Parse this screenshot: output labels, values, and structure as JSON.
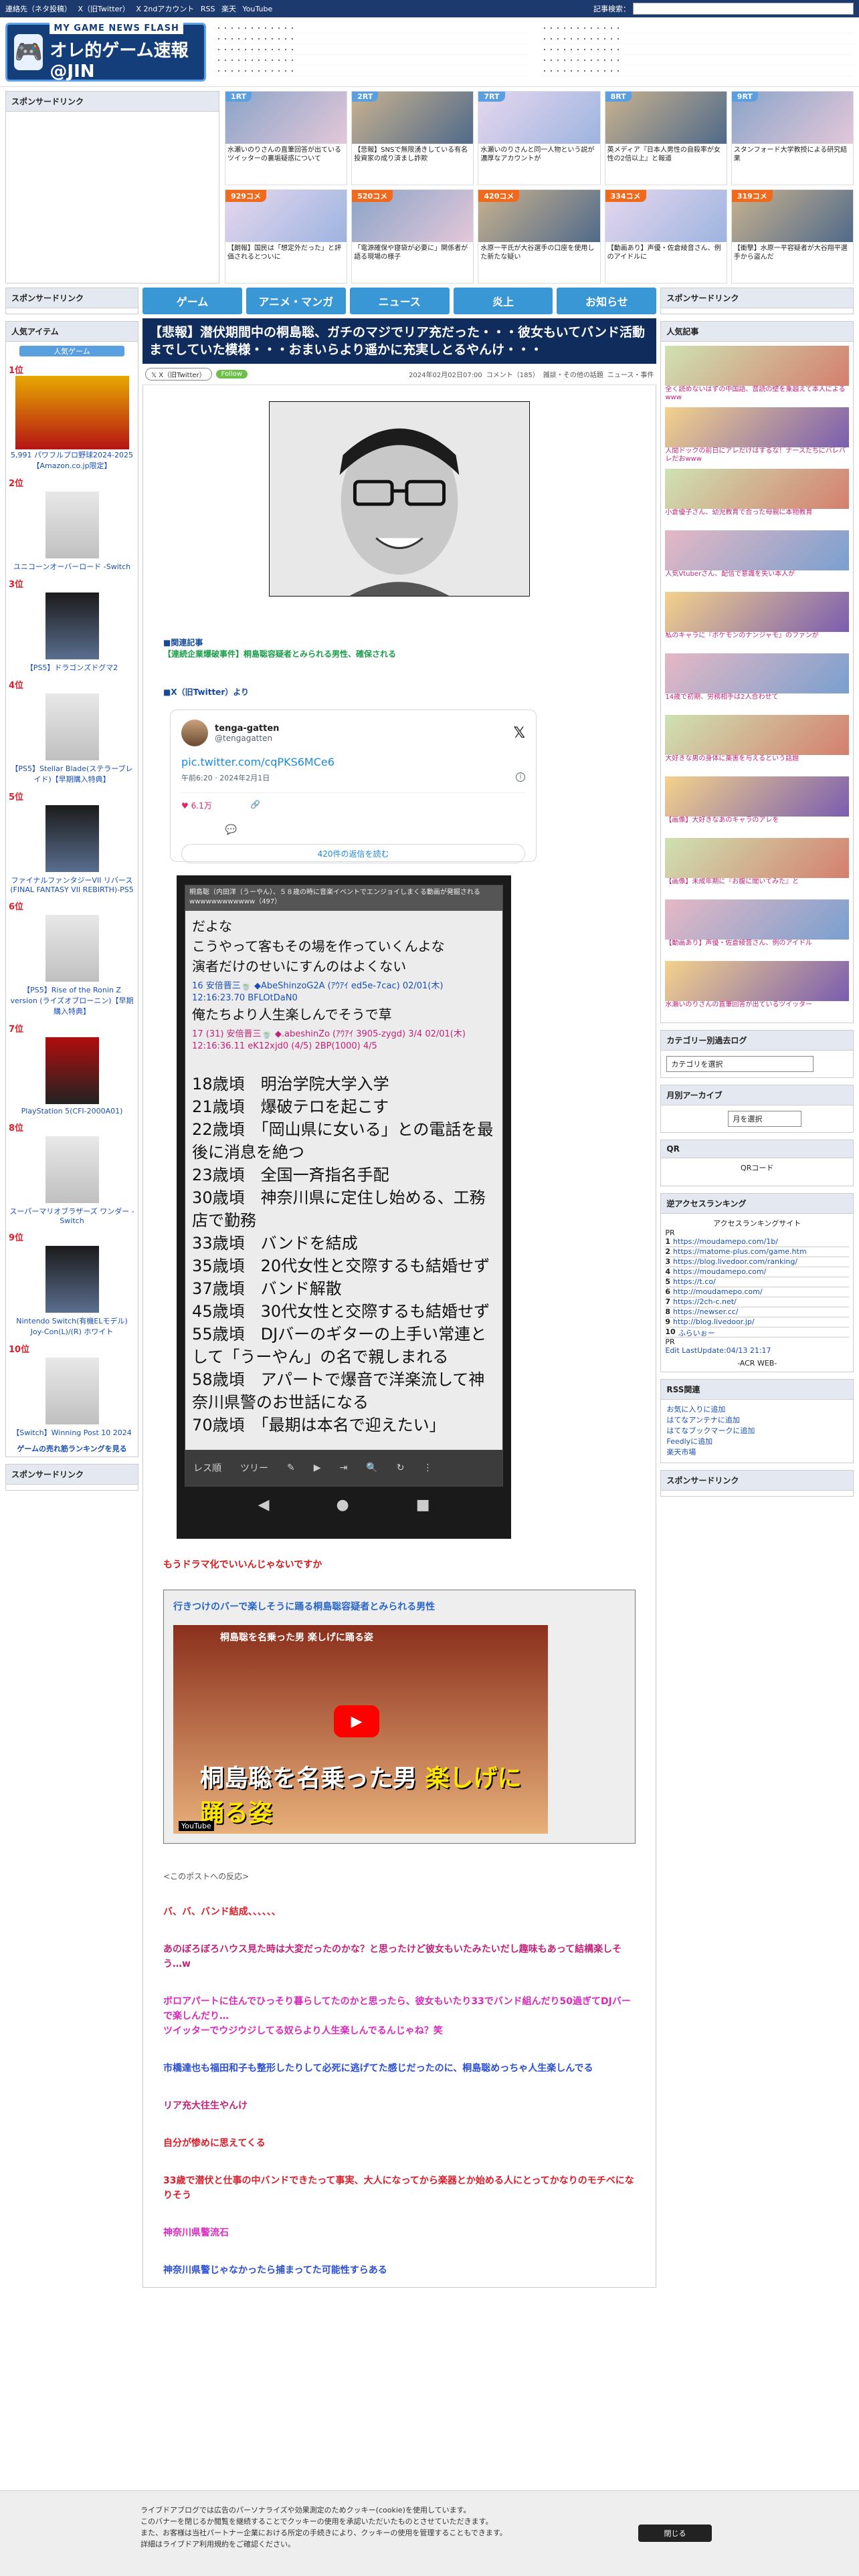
{
  "topbar": {
    "links": [
      "連絡先（ネタ投稿）",
      "X（旧Twitter）",
      "X 2ndアカウント",
      "RSS",
      "楽天",
      "YouTube"
    ],
    "search_label": "記事検索："
  },
  "site": {
    "tagline": "MY GAME NEWS FLASH",
    "name": "オレ的ゲーム速報@JIN"
  },
  "sponsor_label": "スポンサードリンク",
  "rank_cards": [
    {
      "badge": "1RT",
      "text": "水瀬いのりさんの直筆回答が出ているツイッターの裏垢疑惑について"
    },
    {
      "badge": "2RT",
      "text": "【悲報】SNSで無限湧きしている有名投資家の成り済まし詐欺"
    },
    {
      "badge": "7RT",
      "text": "水瀬いのりさんと同一人物という説が濃厚なアカウントが"
    },
    {
      "badge": "8RT",
      "text": "英メディア『日本人男性の自殺率が女性の2倍以上』と報道"
    },
    {
      "badge": "9RT",
      "text": "スタンフォード大学教授による研究結果"
    },
    {
      "badge": "929コメ",
      "text": "【朗報】国民は「想定外だった」と評価されるとついに"
    },
    {
      "badge": "520コメ",
      "text": "「電源確保や寝袋が必要に」関係者が語る現場の様子"
    },
    {
      "badge": "420コメ",
      "text": "水原一平氏が大谷選手の口座を使用した新たな疑い"
    },
    {
      "badge": "334コメ",
      "text": "【動画あり】声優・佐倉綾音さん、例のアイドルに"
    },
    {
      "badge": "319コメ",
      "text": "【衝撃】水原一平容疑者が大谷翔平選手から盗んだ"
    }
  ],
  "nav": [
    "ゲーム",
    "アニメ・マンガ",
    "ニュース",
    "炎上",
    "お知らせ"
  ],
  "article": {
    "title": "【悲報】潜伏期間中の桐島聡、ガチのマジでリア充だった・・・彼女もいてバンド活動までしていた模様・・・おまいらより遥かに充実しとるやんけ・・・",
    "follow": "Follow",
    "x": "X（旧Twitter）",
    "date": "2024年02月02日07:00",
    "comments": "コメント（185）",
    "category": "雑談・その他の話題",
    "tags": "ニュース・事件",
    "related_label": "■関連記事",
    "related_link": "【連続企業爆破事件】桐島聡容疑者とみられる男性、確保される",
    "x_section": "■X（旧Twitter）より",
    "tweet": {
      "name": "tenga-gatten",
      "handle": "@tengagatten",
      "body_link": "pic.twitter.com/cqPKS6MCe6",
      "date": "午前6:20 · 2024年2月1日",
      "likes": "6.1万",
      "reply_btn": "420件の返信を読む"
    },
    "phone": {
      "title": "桐島聡（内田洋（うーやん）、５８歳の時に音楽イベントでエンジョイしまくる動画が発掘されるwwwwwwwwwwww（497）",
      "lines1": [
        "だよな",
        "こうやって客もその場を作っていくんよな",
        "演者だけのせいにすんのはよくない"
      ],
      "r16": "16 安倍晋三🍵 ◆AbeShinzoG2A (ｱｳｱｲ ed5e-7cac) 02/01(木) 12:16:23.70 BFLOtDaN0",
      "l16": "俺たちより人生楽しんでそうで草",
      "r17": "17 (31) 安倍晋三🍵 ◆.abeshinZo (ｱｳｱｲ 3905-zygd) 3/4 02/01(木) 12:16:36.11 eK12xjd0 (4/5) 2BP(1000) 4/5",
      "life": [
        "18歳頃　明治学院大学入学",
        "21歳頃　爆破テロを起こす",
        "22歳頃　「岡山県に女いる」との電話を最後に消息を絶つ",
        "23歳頃　全国一斉指名手配",
        "30歳頃　神奈川県に定住し始める、工務店で勤務",
        "33歳頃　バンドを結成",
        "35歳頃　20代女性と交際するも結婚せず",
        "37歳頃　バンド解散",
        "45歳頃　30代女性と交際するも結婚せず",
        "55歳頃　DJバーのギターの上手い常連として「うーやん」の名で親しまれる",
        "58歳頃　アパートで爆音で洋楽流して神奈川県警のお世話になる",
        "70歳頃　「最期は本名で迎えたい」"
      ],
      "bar": [
        "レス順",
        "ツリー"
      ]
    },
    "caption": "もうドラマ化でいいんじゃないですか",
    "video_head": "行きつけのバーで楽しそうに踊る桐島聡容疑者とみられる男性",
    "video_title": "桐島聡を名乗った男 楽しげに踊る姿",
    "video_cap1": "桐島聡を名乗った男",
    "video_cap2": "楽しげに踊る姿",
    "youtube": "YouTube",
    "reactions_label": "<このポストへの反応>",
    "reactions": [
      {
        "t": "バ、バ、バンド結成、、、、、、",
        "c": "red"
      },
      {
        "t": "あのぼろぼろハウス見た時は大変だったのかな？と思ったけど彼女もいたみたいだし趣味もあって結構楽しそう…w",
        "c": "pink"
      },
      {
        "t": "ボロアパートに住んでひっそり暮らしてたのかと思ったら、彼女もいたり33でバンド組んだり50過ぎてDJバーで楽しんだり…\nツイッターでウジウジしてる奴らより人生楽しんでるんじゃね？笑",
        "c": "mag"
      },
      {
        "t": "市橋達也も福田和子も整形したりして必死に逃げてた感じだったのに、桐島聡めっちゃ人生楽しんでる",
        "c": "blue"
      },
      {
        "t": "リア充大往生やんけ",
        "c": "pink"
      },
      {
        "t": "自分が惨めに思えてくる",
        "c": "red"
      },
      {
        "t": "33歳で潜伏と仕事の中バンドできたって事実、大人になってから楽器とか始める人にとってかなりのモチベになりそう",
        "c": "red"
      },
      {
        "t": "神奈川県警流石",
        "c": "mag"
      },
      {
        "t": "神奈川県警じゃなかったら捕まってた可能性すらある",
        "c": "blue"
      }
    ]
  },
  "left": {
    "title": "人気アイテム",
    "tag": "人気ゲーム",
    "items": [
      {
        "no": "1位",
        "name": "5,991 パワフルプロ野球2024-2025 【Amazon.co.jp限定】"
      },
      {
        "no": "2位",
        "name": "ユニコーンオーバーロード -Switch"
      },
      {
        "no": "3位",
        "name": "【PS5】ドラゴンズドグマ2"
      },
      {
        "no": "4位",
        "name": "【PS5】Stellar Blade(ステラーブレイド)【早期購入特典】"
      },
      {
        "no": "5位",
        "name": "ファイナルファンタジーVII リバース(FINAL FANTASY VII REBIRTH)-PS5"
      },
      {
        "no": "6位",
        "name": "【PS5】Rise of the Ronin Z version (ライズオブローニン)【早期購入特典】"
      },
      {
        "no": "7位",
        "name": "PlayStation 5(CFI-2000A01)"
      },
      {
        "no": "8位",
        "name": "スーパーマリオブラザーズ ワンダー -Switch"
      },
      {
        "no": "9位",
        "name": "Nintendo Switch(有機ELモデル) Joy-Con(L)/(R) ホワイト"
      },
      {
        "no": "10位",
        "name": "【Switch】Winning Post 10 2024"
      }
    ],
    "more": "ゲームの売れ筋ランキングを見る",
    "sponsor2": "スポンサードリンク"
  },
  "right": {
    "sponsor": "スポンサードリンク",
    "popular": "人気記事",
    "pop_items": [
      "全く読めないはずの中国語、音読の壁を乗越えて本人によるwww",
      "人間ドックの前日にアレだけはするな！ナースたちにバレバレだおwww",
      "小倉優子さん、幼児教育で合った母親に本物教育",
      "人気Vtuberさん、配信で意識を失い本人が",
      "私のキャラに『ポケモンのナンジャモ』のファンが",
      "14歳で初期、労務相手は2人合わせて",
      "大好きな男の身体に薬害を与えるという話題",
      "【画像】大好きなあのキャラのアレを",
      "【画像】未成年期に『お腹に聞いてみた』と",
      "【動画あり】声優・佐倉綾音さん、例のアイドル",
      "水瀬いのりさんの直筆回答が出ているツイッター"
    ],
    "cat_log": "カテゴリー別過去ログ",
    "cat_select": "カテゴリを選択",
    "archive": "月別アーカイブ",
    "month_select": "月を選択",
    "qr": "QR",
    "qr_alt": "QRコード",
    "access": "逆アクセスランキング",
    "access_title": "アクセスランキングサイト",
    "access_items": [
      "https://moudamepo.com/1b/",
      "https://matome-plus.com/game.htm",
      "https://blog.livedoor.com/ranking/",
      "https://moudamepo.com/",
      "https://t.co/",
      "http://moudamepo.com/",
      "https://2ch-c.net/",
      "https://newser.cc/",
      "http://blog.livedoor.jp/",
      "ふらいぉー"
    ],
    "access_pr": "PR",
    "access_update": "Edit LastUpdate:04/13 21:17",
    "access_footer": "-ACR WEB-",
    "rss": "RSS関連",
    "rss_links": [
      "お気に入りに追加",
      "はてなアンテナに追加",
      "はてなブックマークに追加",
      "Feedlyに追加",
      "楽天市場"
    ],
    "sponsor3": "スポンサードリンク"
  },
  "cookie": {
    "l1": "ライブドアブログでは広告のパーソナライズや効果測定のためクッキー(cookie)を使用しています。",
    "l2": "このバナーを閉じるか閲覧を継続することでクッキーの使用を承認いただいたものとさせていただきます。",
    "l3": "また、お客様は当社パートナー企業における所定の手続きにより、クッキーの使用を管理することもできます。",
    "l4": "詳細はライブドア利用規約をご確認ください。",
    "close": "閉じる"
  }
}
